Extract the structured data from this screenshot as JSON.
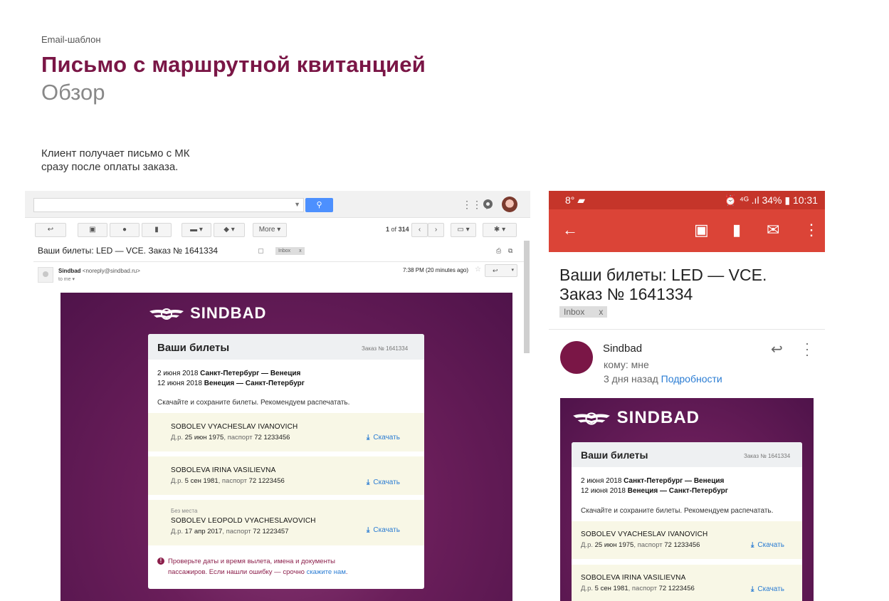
{
  "header": {
    "eyebrow": "Email-шаблон",
    "title": "Письмо с маршрутной квитанцией",
    "subtitle": "Обзор",
    "description_line1": "Клиент получает письмо с МК",
    "description_line2": "сразу после оплаты заказа."
  },
  "desktop": {
    "toolbar": {
      "more_label": "More",
      "page_current": "1",
      "page_of": "of",
      "page_total": "314"
    },
    "subject": "Ваши билеты: LED — VCE. Заказ № 1641334",
    "label": "Inbox",
    "label_close": "x",
    "sender_name": "Sindbad",
    "sender_addr": "<noreply@sindbad.ru>",
    "to_me": "to me",
    "time": "7:38 PM (20 minutes ago)"
  },
  "email": {
    "brand": "SINDBAD",
    "card_title": "Ваши билеты",
    "order": "Заказ № 1641334",
    "route1_date": "2 июня 2018",
    "route1": "Санкт-Петербург — Венеция",
    "route2_date": "12 июня 2018",
    "route2": "Венеция — Санкт-Петербург",
    "hint": "Скачайте и сохраните билеты. Рекомендуем распечатать.",
    "download_label": "Скачать",
    "passengers": [
      {
        "note": "",
        "name": "SOBOLEV VYACHESLAV IVANOVICH",
        "dob_prefix": "Д.р.",
        "dob": "25 июн 1975",
        "passport_prefix": "паспорт",
        "passport": "72 1233456"
      },
      {
        "note": "",
        "name": "SOBOLEVA IRINA VASILIEVNA",
        "dob_prefix": "Д.р.",
        "dob": "5 сен 1981",
        "passport_prefix": "паспорт",
        "passport": "72 1223456"
      },
      {
        "note": "Без места",
        "name": "SOBOLEV LEOPOLD VYACHESLAVOVICH",
        "dob_prefix": "Д.р.",
        "dob": "17 апр 2017",
        "passport_prefix": "паспорт",
        "passport": "72 1223457"
      }
    ],
    "warning_line1": "Проверьте даты и время вылета, имена и документы",
    "warning_line2": "пассажиров. Если нашли ошибку — срочно",
    "warning_link": "скажите нам",
    "warning_end": "."
  },
  "mobile": {
    "status_left": "8°",
    "status_right": "⏰ ⁴ᴳ .ıl 34% ▮ 10:31",
    "subject_line1": "Ваши билеты: LED — VCE.",
    "subject_line2": "Заказ № 1641334",
    "label": "Inbox",
    "label_close": "x",
    "sender": "Sindbad",
    "to": "кому: мне",
    "when": "3 дня назад",
    "details_link": "Подробности"
  }
}
